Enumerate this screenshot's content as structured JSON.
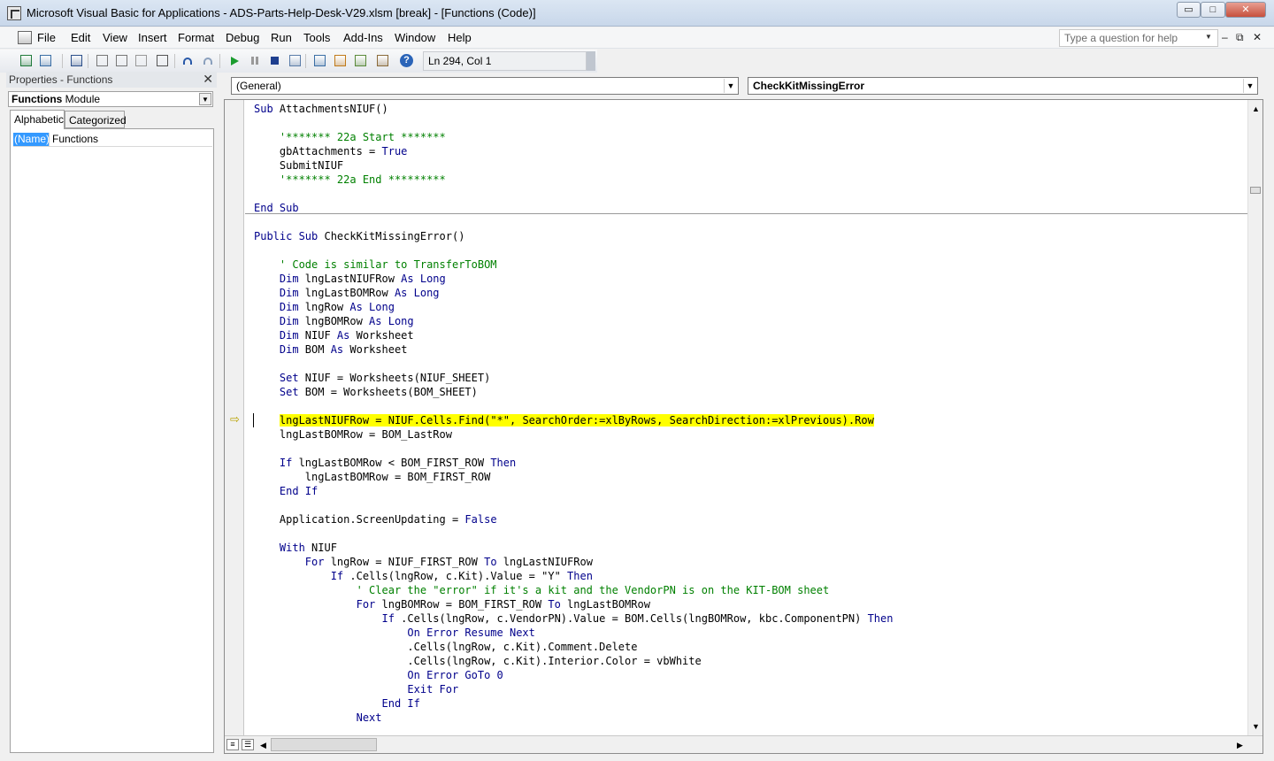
{
  "window": {
    "title": "Microsoft Visual Basic for Applications - ADS-Parts-Help-Desk-V29.xlsm [break] - [Functions (Code)]",
    "min_label": "▭",
    "max_label": "□",
    "close_label": "✕"
  },
  "menu": {
    "items": [
      "File",
      "Edit",
      "View",
      "Insert",
      "Format",
      "Debug",
      "Run",
      "Tools",
      "Add-Ins",
      "Window",
      "Help"
    ],
    "help_placeholder": "Type a question for help",
    "help_dropdown": "▼",
    "mdi_minimize": "‒",
    "mdi_restore": "⧉",
    "mdi_close": "✕"
  },
  "toolbar": {
    "position": "Ln 294, Col 1",
    "icons": [
      "view-excel-icon",
      "insert-userform-icon",
      "save-icon",
      "cut-icon",
      "copy-icon",
      "paste-icon",
      "find-icon",
      "undo-icon",
      "redo-icon",
      "run-icon",
      "break-icon",
      "reset-icon",
      "design-mode-icon",
      "project-explorer-icon",
      "properties-window-icon",
      "object-browser-icon",
      "toolbox-icon",
      "help-icon"
    ]
  },
  "properties": {
    "title": "Properties - Functions",
    "close": "✕",
    "object_name": "Functions",
    "object_type": "Module",
    "tabs": [
      "Alphabetic",
      "Categorized"
    ],
    "row_name": "(Name)",
    "row_value": "Functions"
  },
  "code": {
    "object_combo": "(General)",
    "proc_combo": "CheckKitMissingError",
    "lines": [
      {
        "i": 0,
        "parts": [
          {
            "t": "Sub ",
            "c": "kw"
          },
          {
            "t": "AttachmentsNIUF()",
            "c": ""
          }
        ]
      },
      {
        "i": 2,
        "parts": [
          {
            "t": "    '******* 22a Start *******",
            "c": "cm"
          }
        ]
      },
      {
        "i": 3,
        "parts": [
          {
            "t": "    gbAttachments = ",
            "c": ""
          },
          {
            "t": "True",
            "c": "kw"
          }
        ]
      },
      {
        "i": 4,
        "parts": [
          {
            "t": "    SubmitNIUF",
            "c": ""
          }
        ]
      },
      {
        "i": 5,
        "parts": [
          {
            "t": "    '******* 22a End *********",
            "c": "cm"
          }
        ]
      },
      {
        "i": 7,
        "parts": [
          {
            "t": "End Sub",
            "c": "kw"
          }
        ]
      },
      {
        "i": 9,
        "parts": [
          {
            "t": "Public Sub ",
            "c": "kw"
          },
          {
            "t": "CheckKitMissingError()",
            "c": ""
          }
        ]
      },
      {
        "i": 11,
        "parts": [
          {
            "t": "    ' Code is similar to TransferToBOM",
            "c": "cm"
          }
        ]
      },
      {
        "i": 12,
        "parts": [
          {
            "t": "    Dim ",
            "c": "kw"
          },
          {
            "t": "lngLastNIUFRow ",
            "c": ""
          },
          {
            "t": "As Long",
            "c": "kw"
          }
        ]
      },
      {
        "i": 13,
        "parts": [
          {
            "t": "    Dim ",
            "c": "kw"
          },
          {
            "t": "lngLastBOMRow ",
            "c": ""
          },
          {
            "t": "As Long",
            "c": "kw"
          }
        ]
      },
      {
        "i": 14,
        "parts": [
          {
            "t": "    Dim ",
            "c": "kw"
          },
          {
            "t": "lngRow ",
            "c": ""
          },
          {
            "t": "As Long",
            "c": "kw"
          }
        ]
      },
      {
        "i": 15,
        "parts": [
          {
            "t": "    Dim ",
            "c": "kw"
          },
          {
            "t": "lngBOMRow ",
            "c": ""
          },
          {
            "t": "As Long",
            "c": "kw"
          }
        ]
      },
      {
        "i": 16,
        "parts": [
          {
            "t": "    Dim ",
            "c": "kw"
          },
          {
            "t": "NIUF ",
            "c": ""
          },
          {
            "t": "As ",
            "c": "kw"
          },
          {
            "t": "Worksheet",
            "c": ""
          }
        ]
      },
      {
        "i": 17,
        "parts": [
          {
            "t": "    Dim ",
            "c": "kw"
          },
          {
            "t": "BOM ",
            "c": ""
          },
          {
            "t": "As ",
            "c": "kw"
          },
          {
            "t": "Worksheet",
            "c": ""
          }
        ]
      },
      {
        "i": 19,
        "parts": [
          {
            "t": "    Set ",
            "c": "kw"
          },
          {
            "t": "NIUF = Worksheets(NIUF_SHEET)",
            "c": ""
          }
        ]
      },
      {
        "i": 20,
        "parts": [
          {
            "t": "    Set ",
            "c": "kw"
          },
          {
            "t": "BOM = Worksheets(BOM_SHEET)",
            "c": ""
          }
        ]
      },
      {
        "i": 22,
        "parts": [
          {
            "t": "    ",
            "c": ""
          },
          {
            "t": "lngLastNIUFRow = NIUF.Cells.Find(\"*\", SearchOrder:=xlByRows, SearchDirection:=xlPrevious).Row",
            "c": "hl"
          }
        ]
      },
      {
        "i": 23,
        "parts": [
          {
            "t": "    lngLastBOMRow = BOM_LastRow",
            "c": ""
          }
        ]
      },
      {
        "i": 25,
        "parts": [
          {
            "t": "    If ",
            "c": "kw"
          },
          {
            "t": "lngLastBOMRow < BOM_FIRST_ROW ",
            "c": ""
          },
          {
            "t": "Then",
            "c": "kw"
          }
        ]
      },
      {
        "i": 26,
        "parts": [
          {
            "t": "        lngLastBOMRow = BOM_FIRST_ROW",
            "c": ""
          }
        ]
      },
      {
        "i": 27,
        "parts": [
          {
            "t": "    End If",
            "c": "kw"
          }
        ]
      },
      {
        "i": 29,
        "parts": [
          {
            "t": "    Application.ScreenUpdating = ",
            "c": ""
          },
          {
            "t": "False",
            "c": "kw"
          }
        ]
      },
      {
        "i": 31,
        "parts": [
          {
            "t": "    With ",
            "c": "kw"
          },
          {
            "t": "NIUF",
            "c": ""
          }
        ]
      },
      {
        "i": 32,
        "parts": [
          {
            "t": "        For ",
            "c": "kw"
          },
          {
            "t": "lngRow = NIUF_FIRST_ROW ",
            "c": ""
          },
          {
            "t": "To ",
            "c": "kw"
          },
          {
            "t": "lngLastNIUFRow",
            "c": ""
          }
        ]
      },
      {
        "i": 33,
        "parts": [
          {
            "t": "            If ",
            "c": "kw"
          },
          {
            "t": ".Cells(lngRow, c.Kit).Value = \"Y\" ",
            "c": ""
          },
          {
            "t": "Then",
            "c": "kw"
          }
        ]
      },
      {
        "i": 34,
        "parts": [
          {
            "t": "                ' Clear the \"error\" if it's a kit and the VendorPN is on the KIT-BOM sheet",
            "c": "cm"
          }
        ]
      },
      {
        "i": 35,
        "parts": [
          {
            "t": "                For ",
            "c": "kw"
          },
          {
            "t": "lngBOMRow = BOM_FIRST_ROW ",
            "c": ""
          },
          {
            "t": "To ",
            "c": "kw"
          },
          {
            "t": "lngLastBOMRow",
            "c": ""
          }
        ]
      },
      {
        "i": 36,
        "parts": [
          {
            "t": "                    If ",
            "c": "kw"
          },
          {
            "t": ".Cells(lngRow, c.VendorPN).Value = BOM.Cells(lngBOMRow, kbc.ComponentPN) ",
            "c": ""
          },
          {
            "t": "Then",
            "c": "kw"
          }
        ]
      },
      {
        "i": 37,
        "parts": [
          {
            "t": "                        On Error Resume Next",
            "c": "kw"
          }
        ]
      },
      {
        "i": 38,
        "parts": [
          {
            "t": "                        .Cells(lngRow, c.Kit).Comment.Delete",
            "c": ""
          }
        ]
      },
      {
        "i": 39,
        "parts": [
          {
            "t": "                        .Cells(lngRow, c.Kit).Interior.Color = vbWhite",
            "c": ""
          }
        ]
      },
      {
        "i": 40,
        "parts": [
          {
            "t": "                        On Error GoTo 0",
            "c": "kw"
          }
        ]
      },
      {
        "i": 41,
        "parts": [
          {
            "t": "                        Exit For",
            "c": "kw"
          }
        ]
      },
      {
        "i": 42,
        "parts": [
          {
            "t": "                    End If",
            "c": "kw"
          }
        ]
      },
      {
        "i": 43,
        "parts": [
          {
            "t": "                Next",
            "c": "kw"
          }
        ]
      }
    ]
  },
  "colors": {
    "keyword": "#00008b",
    "comment": "#008000",
    "highlight": "#ffff00",
    "selection": "#3399ff"
  }
}
